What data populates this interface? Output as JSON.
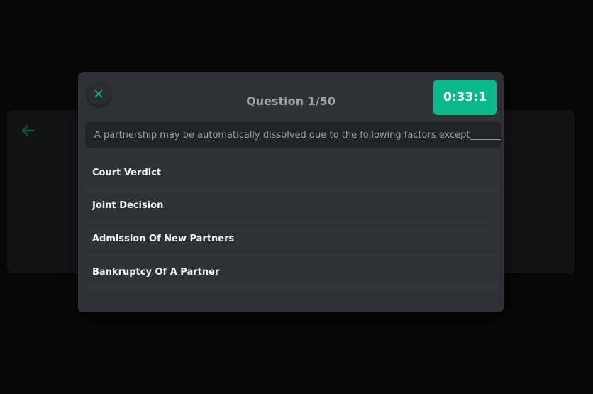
{
  "quiz": {
    "question_counter": "Question 1/50",
    "timer": "0:33:1",
    "question_text": "A partnership may be automatically dissolved due to the following factors except________",
    "options": [
      {
        "label": "Court Verdict"
      },
      {
        "label": "Joint Decision"
      },
      {
        "label": "Admission Of New Partners"
      },
      {
        "label": "Bankruptcy Of A Partner"
      }
    ]
  },
  "icons": {
    "close": "close-icon",
    "back": "arrow-left-icon"
  },
  "colors": {
    "accent": "#0bb98a",
    "modal_bg": "#2f3236",
    "page_bg": "#070707"
  }
}
